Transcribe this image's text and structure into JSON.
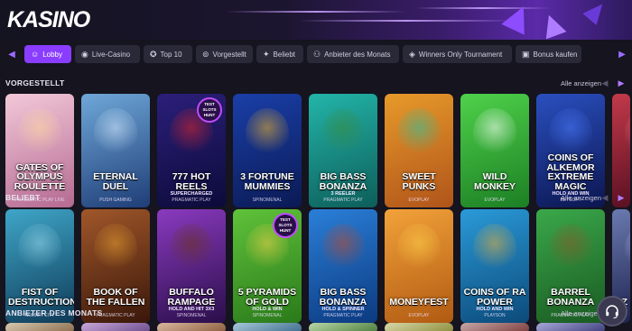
{
  "header": {
    "logo": "KASINO"
  },
  "tabs": [
    {
      "label": "Lobby",
      "icon": "lobby-icon",
      "glyph": "☺",
      "active": true
    },
    {
      "label": "Live-Casino",
      "icon": "live-icon",
      "glyph": "◉",
      "active": false
    },
    {
      "label": "Top 10",
      "icon": "medal-icon",
      "glyph": "✪",
      "active": false
    },
    {
      "label": "Vorgestellt",
      "icon": "featured-icon",
      "glyph": "⊚",
      "active": false
    },
    {
      "label": "Beliebt",
      "icon": "sparkle-icon",
      "glyph": "✦",
      "active": false
    },
    {
      "label": "Anbieter des Monats",
      "icon": "provider-icon",
      "glyph": "⚇",
      "active": false
    },
    {
      "label": "Winners Only Tournament",
      "icon": "tournament-icon",
      "glyph": "◈",
      "active": false
    },
    {
      "label": "Bonus kaufen",
      "icon": "cart-icon",
      "glyph": "▣",
      "active": false
    }
  ],
  "sections": [
    {
      "title": "VORGESTELLT",
      "all_label": "Alle anzeigen"
    },
    {
      "title": "BELIEBT",
      "all_label": "Alle anzeigen"
    },
    {
      "title": "ANBIETER DES MONATS",
      "all_label": "Alle anzeigen"
    }
  ],
  "featured": [
    {
      "title": "Gates of Olympus Roulette",
      "sub": "Pragmatic Play Live",
      "colors": [
        "#f2c8d8",
        "#b56a92"
      ],
      "art": "#ffd9a0"
    },
    {
      "title": "Eternal Duel",
      "sub": "Push Gaming",
      "colors": [
        "#6fa8d8",
        "#1f3d77"
      ],
      "art": "#d8ecff"
    },
    {
      "title": "777 Hot Reels",
      "sub": "Pragmatic Play",
      "badge": "TEST SLOTS HUNT",
      "tagline": "Supercharged",
      "colors": [
        "#2b1f7a",
        "#0c0b3a"
      ],
      "art": "#e0262a"
    },
    {
      "title": "3 Fortune Mummies",
      "sub": "Spinomenal",
      "colors": [
        "#1a3fa8",
        "#0b1a55"
      ],
      "art": "#f2b52a"
    },
    {
      "title": "Big Bass Bonanza",
      "sub": "Pragmatic Play",
      "tagline": "3 Reeler",
      "colors": [
        "#23b5a9",
        "#0d5e5a"
      ],
      "art": "#3a8a3a"
    },
    {
      "title": "Sweet Punks",
      "sub": "Evoplay",
      "colors": [
        "#e79a2a",
        "#b0541a"
      ],
      "art": "#2ac2a2"
    },
    {
      "title": "Wild Monkey",
      "sub": "Evoplay",
      "colors": [
        "#4fd14a",
        "#1c7f24"
      ],
      "art": "#ffffff"
    },
    {
      "title": "Coins of Alkemor Extreme Magic",
      "sub": "Betsoft",
      "tagline": "Hold and Win",
      "colors": [
        "#2a4fbf",
        "#0c1650"
      ],
      "art": "#4a7cff"
    },
    {
      "title": "",
      "sub": "",
      "colors": [
        "#c23a4a",
        "#5a1022"
      ],
      "art": "#ff7a8a"
    }
  ],
  "popular": [
    {
      "title": "Fist of Destruction",
      "sub": "Nolimit City",
      "colors": [
        "#3fa6c8",
        "#0f3b58"
      ],
      "art": "#9ad8ea"
    },
    {
      "title": "Book of the Fallen",
      "sub": "Pragmatic Play",
      "colors": [
        "#a0572a",
        "#3a170a"
      ],
      "art": "#e5a030"
    },
    {
      "title": "Buffalo Rampage",
      "sub": "Spinomenal",
      "tagline": "Hold and Hit 3x3",
      "colors": [
        "#8a3abf",
        "#2a0e4a"
      ],
      "art": "#6a3418"
    },
    {
      "title": "5 Pyramids of Gold",
      "sub": "Spinomenal",
      "badge": "TEST SLOTS HUNT",
      "tagline": "Hold & Win",
      "colors": [
        "#5fc23a",
        "#2a7a1a"
      ],
      "art": "#f2d24a"
    },
    {
      "title": "Big Bass Bonanza",
      "sub": "Pragmatic Play",
      "tagline": "Hold & Spinner",
      "colors": [
        "#2a7fd8",
        "#0c3a80"
      ],
      "art": "#c04a2a"
    },
    {
      "title": "Moneyfest",
      "sub": "Evoplay",
      "colors": [
        "#f2a23a",
        "#b05a12"
      ],
      "art": "#ffd24a"
    },
    {
      "title": "Coins of Ra Power",
      "sub": "Playson",
      "tagline": "Hold and Win",
      "colors": [
        "#2a9ad8",
        "#0c4a7a"
      ],
      "art": "#e5b03a"
    },
    {
      "title": "Barrel Bonanza",
      "sub": "Pragmatic Play",
      "colors": [
        "#3aa84a",
        "#1a5a22"
      ],
      "art": "#8a5a2a"
    },
    {
      "title": "AZ",
      "sub": "",
      "colors": [
        "#6a7ab0",
        "#1e2450"
      ],
      "art": "#c8d0ff"
    }
  ],
  "provider_row": [
    {
      "colors": [
        "#d8c8b0",
        "#8a6a4a"
      ]
    },
    {
      "colors": [
        "#c8a8d8",
        "#6a4a8a"
      ]
    },
    {
      "colors": [
        "#d8b8a0",
        "#8a5a3a"
      ]
    },
    {
      "colors": [
        "#a8c8d8",
        "#3a6a8a"
      ]
    },
    {
      "colors": [
        "#b8d8a8",
        "#4a7a3a"
      ]
    },
    {
      "colors": [
        "#d8d8a8",
        "#8a8a3a"
      ]
    },
    {
      "colors": [
        "#c8a8a8",
        "#7a3a3a"
      ]
    },
    {
      "colors": [
        "#a8a8d8",
        "#3a3a7a"
      ]
    }
  ],
  "support": {
    "icon": "headset-icon"
  }
}
